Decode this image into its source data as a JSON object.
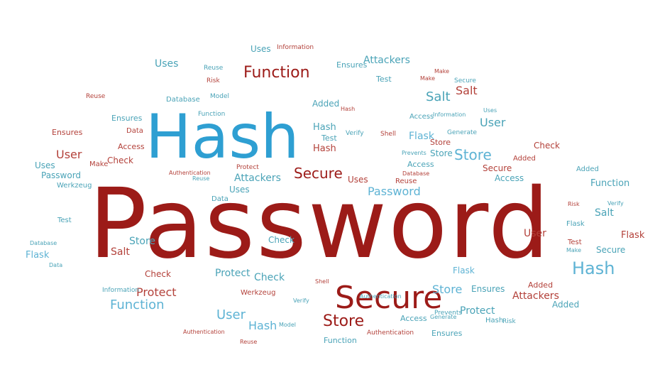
{
  "colors": {
    "primary_red": "#9c1b18",
    "primary_blue": "#2e9fd2",
    "teal": "#4aa3b7",
    "rose": "#b3413a",
    "light_blue": "#5eb3d4"
  },
  "words": {
    "password": "Password",
    "hash": "Hash",
    "secure": "Secure",
    "function": "Function",
    "store": "Store",
    "user": "User",
    "salt": "Salt",
    "attackers": "Attackers",
    "protect": "Protect",
    "check": "Check",
    "uses": "Uses",
    "flask": "Flask",
    "ensures": "Ensures",
    "added": "Added",
    "access": "Access",
    "test": "Test",
    "reuse": "Reuse",
    "data": "Data",
    "werkzeug": "Werkzeug",
    "database": "Database",
    "information": "Information",
    "authentication": "Authentication",
    "prevents": "Prevents",
    "generate": "Generate",
    "verify": "Verify",
    "shell": "Shell",
    "make": "Make",
    "model": "Model",
    "risk": "Risk"
  }
}
